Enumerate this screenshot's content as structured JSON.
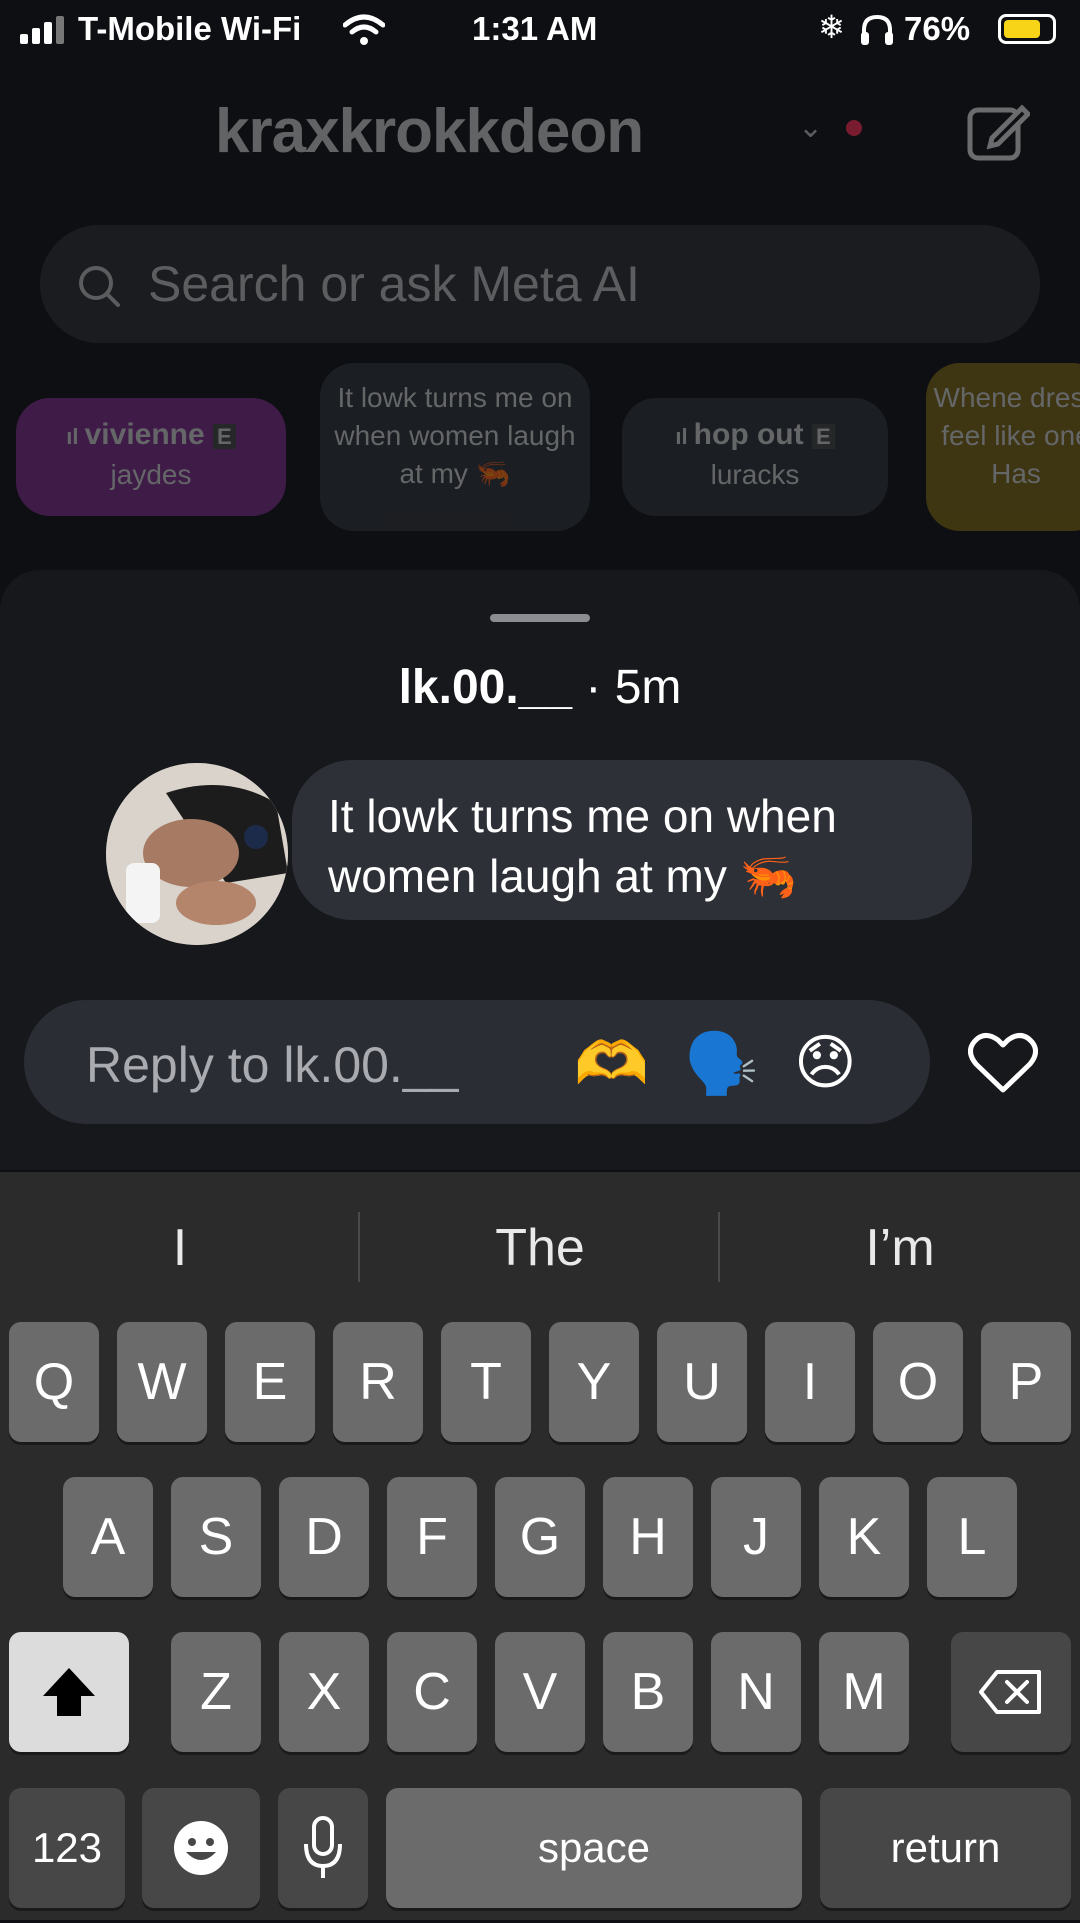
{
  "status": {
    "carrier": "T-Mobile Wi-Fi",
    "time": "1:31 AM",
    "battery": "76%",
    "icons": [
      "signal-icon",
      "wifi-icon",
      "snowflake-icon",
      "headphones-icon",
      "battery-icon"
    ]
  },
  "header": {
    "username": "kraxkrokkdeon",
    "search_placeholder": "Search or ask Meta AI"
  },
  "notes": [
    {
      "title": "vivienne",
      "subtitle": "jaydes",
      "type": "music"
    },
    {
      "text": "It lowk turns me on when women laugh at my 🦐",
      "type": "text"
    },
    {
      "title": "hop out",
      "subtitle": "luracks",
      "type": "music"
    },
    {
      "text": "Whene dress feel like one Has",
      "type": "text"
    }
  ],
  "sheet": {
    "author": "lk.00.__",
    "time_ago": "· 5m",
    "message": "It lowk turns me on when women laugh at my 🦐",
    "reply_placeholder": "Reply to lk.00.__",
    "quick_reactions": [
      "🫶",
      "🗣️",
      "😞"
    ]
  },
  "keyboard": {
    "suggestions": [
      "I",
      "The",
      "I’m"
    ],
    "row1": [
      "Q",
      "W",
      "E",
      "R",
      "T",
      "Y",
      "U",
      "I",
      "O",
      "P"
    ],
    "row2": [
      "A",
      "S",
      "D",
      "F",
      "G",
      "H",
      "J",
      "K",
      "L"
    ],
    "row3": [
      "Z",
      "X",
      "C",
      "V",
      "B",
      "N",
      "M"
    ],
    "numbers_label": "123",
    "space_label": "space",
    "return_label": "return"
  }
}
